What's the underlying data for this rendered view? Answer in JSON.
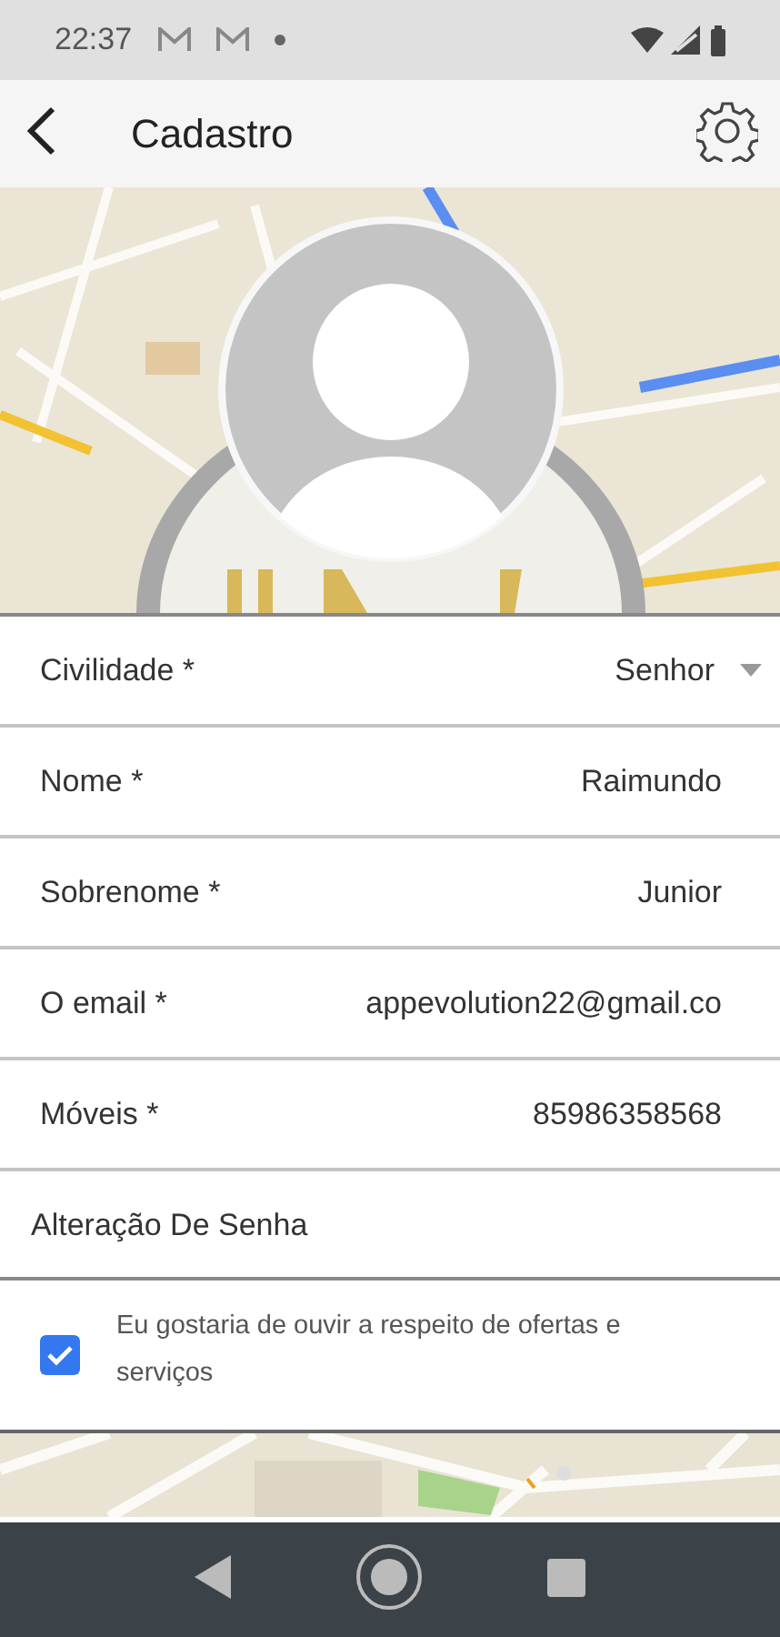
{
  "status_bar": {
    "time": "22:37"
  },
  "app_bar": {
    "title": "Cadastro"
  },
  "form": [
    {
      "kind": "select",
      "label": "Civilidade *",
      "value": "Senhor"
    },
    {
      "kind": "text",
      "label": "Nome *",
      "value": "Raimundo"
    },
    {
      "kind": "text",
      "label": "Sobrenome *",
      "value": "Junior"
    },
    {
      "kind": "text",
      "label": "O email *",
      "value": "appevolution22@gmail.co"
    },
    {
      "kind": "text",
      "label": "Móveis *",
      "value": "85986358568"
    }
  ],
  "password_link": "Alteração De Senha",
  "consent": {
    "text": "Eu gostaria de ouvir a respeito de ofertas e serviços",
    "checked": true
  }
}
